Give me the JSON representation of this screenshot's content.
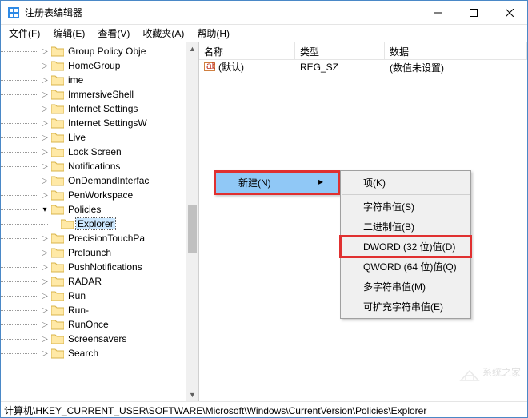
{
  "title": "注册表编辑器",
  "menubar": {
    "file": "文件(F)",
    "edit": "编辑(E)",
    "view": "查看(V)",
    "favorites": "收藏夹(A)",
    "help": "帮助(H)"
  },
  "tree": {
    "items": [
      {
        "label": "Group Policy Obje",
        "depth": 4,
        "exp": "closed"
      },
      {
        "label": "HomeGroup",
        "depth": 4,
        "exp": "closed"
      },
      {
        "label": "ime",
        "depth": 4,
        "exp": "closed"
      },
      {
        "label": "ImmersiveShell",
        "depth": 4,
        "exp": "closed"
      },
      {
        "label": "Internet Settings",
        "depth": 4,
        "exp": "closed"
      },
      {
        "label": "Internet SettingsW",
        "depth": 4,
        "exp": "closed"
      },
      {
        "label": "Live",
        "depth": 4,
        "exp": "closed"
      },
      {
        "label": "Lock Screen",
        "depth": 4,
        "exp": "closed"
      },
      {
        "label": "Notifications",
        "depth": 4,
        "exp": "closed"
      },
      {
        "label": "OnDemandInterfac",
        "depth": 4,
        "exp": "closed"
      },
      {
        "label": "PenWorkspace",
        "depth": 4,
        "exp": "closed"
      },
      {
        "label": "Policies",
        "depth": 4,
        "exp": "open"
      },
      {
        "label": "Explorer",
        "depth": 5,
        "exp": "none",
        "selected": true
      },
      {
        "label": "PrecisionTouchPa",
        "depth": 4,
        "exp": "closed"
      },
      {
        "label": "Prelaunch",
        "depth": 4,
        "exp": "closed"
      },
      {
        "label": "PushNotifications",
        "depth": 4,
        "exp": "closed"
      },
      {
        "label": "RADAR",
        "depth": 4,
        "exp": "closed"
      },
      {
        "label": "Run",
        "depth": 4,
        "exp": "closed"
      },
      {
        "label": "Run-",
        "depth": 4,
        "exp": "closed"
      },
      {
        "label": "RunOnce",
        "depth": 4,
        "exp": "closed"
      },
      {
        "label": "Screensavers",
        "depth": 4,
        "exp": "closed"
      },
      {
        "label": "Search",
        "depth": 4,
        "exp": "closed"
      }
    ]
  },
  "list": {
    "headers": {
      "name": "名称",
      "type": "类型",
      "data": "数据"
    },
    "rows": [
      {
        "name": "(默认)",
        "type": "REG_SZ",
        "data": "(数值未设置)"
      }
    ]
  },
  "context": {
    "new": "新建(N)",
    "sub": {
      "key": "项(K)",
      "string": "字符串值(S)",
      "binary": "二进制值(B)",
      "dword": "DWORD (32 位)值(D)",
      "qword": "QWORD (64 位)值(Q)",
      "multistring": "多字符串值(M)",
      "expandstring": "可扩充字符串值(E)"
    }
  },
  "statusbar": "计算机\\HKEY_CURRENT_USER\\SOFTWARE\\Microsoft\\Windows\\CurrentVersion\\Policies\\Explorer",
  "watermark": "系统之家"
}
